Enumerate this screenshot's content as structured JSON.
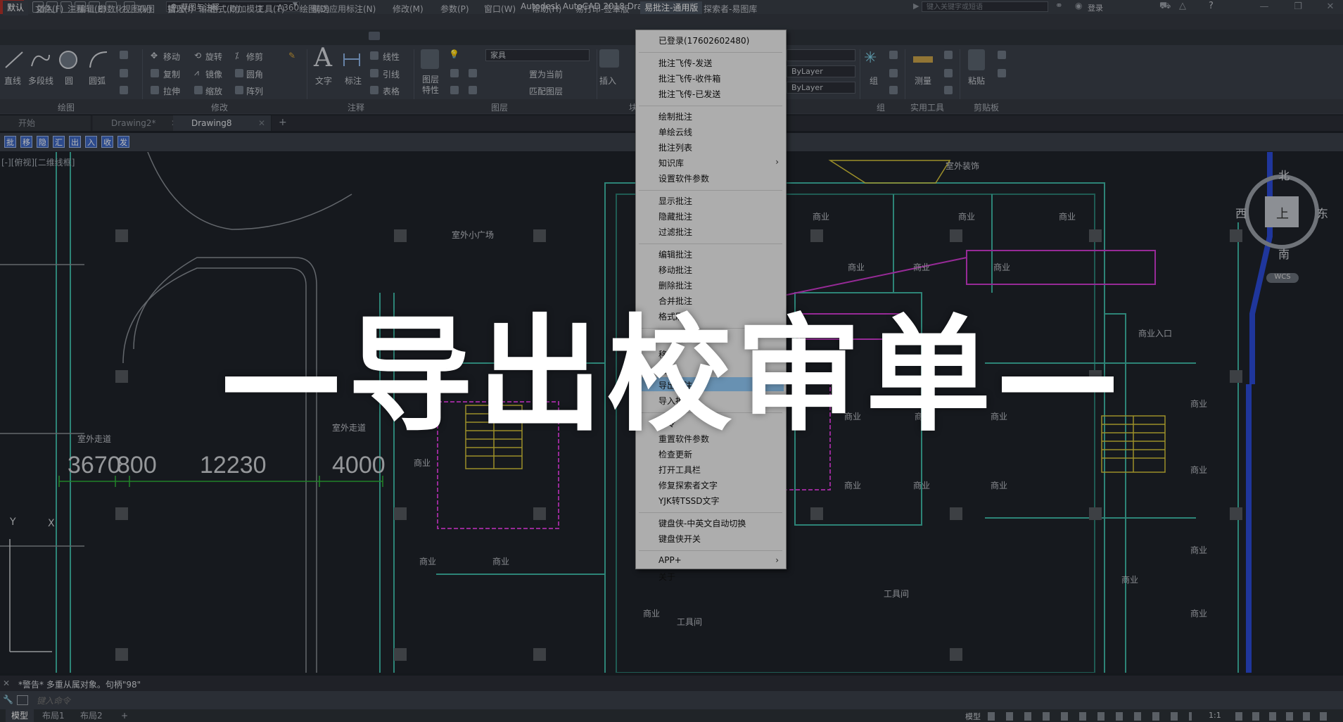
{
  "app": {
    "logo_letter": "A",
    "workspace": "草图与注释",
    "window_title": "Autodesk AutoCAD 2018    Drawing8.dwg",
    "search_placeholder": "键入关键字或短语",
    "login": "登录"
  },
  "menubar": {
    "items": [
      "文件(F)",
      "编辑(E)",
      "视图(V)",
      "插入(I)",
      "格式(O)",
      "工具(T)",
      "绘图(D)",
      "标注(N)",
      "修改(M)",
      "参数(P)",
      "窗口(W)",
      "帮助(H)",
      "易打印-签章版",
      "易批注-通用版",
      "探索者-易图库"
    ],
    "active_index": 13
  },
  "ribbon_tabs": {
    "items": [
      "默认",
      "插入",
      "注释",
      "参数化",
      "视图",
      "管理",
      "输出",
      "附加模块",
      "A360",
      "精选应用"
    ],
    "selected_index": 0
  },
  "ribbon": {
    "draw": {
      "line": "直线",
      "polyline": "多段线",
      "circle": "圆",
      "arc": "圆弧"
    },
    "modify": {
      "move": "移动",
      "rotate": "旋转",
      "trim": "修剪",
      "copy": "复制",
      "mirror": "镜像",
      "fillet": "圆角",
      "stretch": "拉伸",
      "scale": "缩放",
      "array": "阵列"
    },
    "annotation": {
      "text": "文字",
      "dimension": "标注",
      "linear": "线性",
      "leader": "引线",
      "table": "表格"
    },
    "layers": {
      "properties": "图层\n特性",
      "current_layer": "家具",
      "set_current": "置为当前",
      "match_layer": "匹配图层"
    },
    "block": {
      "insert": "插入"
    },
    "properties": {
      "bylayer1": "ByLayer",
      "bylayer2": "ByLayer"
    },
    "groups": {
      "group": "组"
    },
    "utilities": {
      "measure": "测量"
    },
    "clipboard": {
      "paste": "粘贴"
    },
    "panel_titles": [
      "绘图",
      "修改",
      "注释",
      "图层",
      "块",
      "组",
      "实用工具",
      "剪贴板"
    ]
  },
  "doc_tabs": {
    "items": [
      "开始",
      "Drawing2*",
      "Drawing8"
    ],
    "selected_index": 2,
    "add": "+"
  },
  "custom_toolbar": {
    "buttons": [
      "批",
      "移",
      "隐",
      "汇",
      "出",
      "入",
      "收",
      "发"
    ]
  },
  "viewport": {
    "label": "[-][俯视][二维线框]"
  },
  "drawing": {
    "labels": [
      "室外小广场",
      "室外走道",
      "室外走道",
      "商业",
      "商业",
      "商业",
      "商业",
      "商业",
      "商业",
      "商业",
      "商业",
      "商业",
      "商业",
      "商业",
      "商业",
      "商业",
      "商业",
      "商业",
      "商业",
      "商业",
      "商业",
      "商业",
      "商业",
      "商业",
      "室外装饰",
      "商业入口",
      "工具间",
      "工具间"
    ],
    "dimensions": [
      "3670",
      "800",
      "12230",
      "4000"
    ]
  },
  "viewcube": {
    "north": "北",
    "south": "南",
    "east": "东",
    "west": "西",
    "top": "上",
    "wcs": "WCS"
  },
  "context_menu": {
    "items": [
      {
        "label": "已登录(17602602480)"
      },
      {
        "sep": true
      },
      {
        "label": "批注飞传-发送"
      },
      {
        "label": "批注飞传-收件箱"
      },
      {
        "label": "批注飞传-已发送"
      },
      {
        "sep": true
      },
      {
        "label": "绘制批注"
      },
      {
        "label": "单绘云线"
      },
      {
        "label": "批注列表"
      },
      {
        "label": "知识库",
        "submenu": true
      },
      {
        "label": "设置软件参数"
      },
      {
        "sep": true
      },
      {
        "label": "显示批注"
      },
      {
        "label": "隐藏批注"
      },
      {
        "label": "过滤批注"
      },
      {
        "sep": true
      },
      {
        "label": "编辑批注"
      },
      {
        "label": "移动批注"
      },
      {
        "label": "删除批注"
      },
      {
        "label": "合并批注"
      },
      {
        "label": "格式刷"
      },
      {
        "sep": true
      },
      {
        "label": "汇总批注"
      },
      {
        "label": "移动"
      },
      {
        "label": "更"
      },
      {
        "label": "导出批注",
        "highlighted": true
      },
      {
        "label": "导入批注"
      },
      {
        "sep": true
      },
      {
        "label": "命令"
      },
      {
        "label": "重置软件参数"
      },
      {
        "label": "检查更新"
      },
      {
        "label": "打开工具栏"
      },
      {
        "label": "修复探索者文字"
      },
      {
        "label": "YJK转TSSD文字"
      },
      {
        "sep": true
      },
      {
        "label": "键盘侠-中英文自动切换"
      },
      {
        "label": "键盘侠开关"
      },
      {
        "sep": true
      },
      {
        "label": "APP+",
        "submenu": true
      },
      {
        "label": "关于"
      }
    ]
  },
  "overlay_title": "—导出校审单—",
  "command": {
    "history": "*警告* 多重从属对象。句柄\"98\"",
    "placeholder": "键入命令"
  },
  "layout_tabs": {
    "items": [
      "模型",
      "布局1",
      "布局2"
    ],
    "selected_index": 0,
    "add": "+"
  },
  "status": {
    "model": "模型",
    "scale": "1:1"
  },
  "colors": {
    "accent": "#3d67c2",
    "highlight": "#91c9f7",
    "ribbon_bg": "#3b414a",
    "canvas_bg": "#1f232a",
    "annot_magenta": "#d23bd2",
    "wall_cyan": "#3fb7a6",
    "stair_yellow": "#d9c63a"
  }
}
